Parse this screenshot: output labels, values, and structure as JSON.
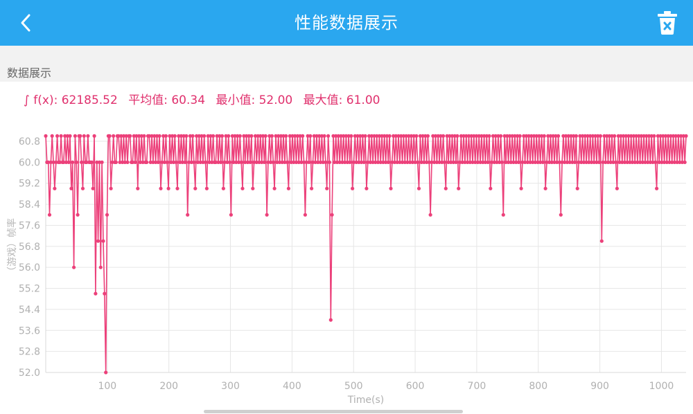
{
  "header": {
    "title": "性能数据展示",
    "back_icon": "chevron-left-icon",
    "delete_icon": "trash-icon",
    "bar_color": "#2aa7ef"
  },
  "section": {
    "label": "数据展示"
  },
  "summary": {
    "integral": "∫ f(x): 62185.52",
    "average": "平均值: 60.34",
    "min": "最小值: 52.00",
    "max": "最大值: 61.00"
  },
  "chart_data": {
    "type": "line",
    "xlabel": "Time(s)",
    "ylabel": "（游戏）帧率",
    "ylim": [
      52.0,
      60.8
    ],
    "xlim": [
      0,
      1040
    ],
    "y_ticks": [
      "52.0",
      "52.8",
      "53.6",
      "54.4",
      "55.2",
      "56.0",
      "56.8",
      "57.6",
      "58.4",
      "59.2",
      "60.0",
      "60.8"
    ],
    "x_ticks": [
      "100",
      "200",
      "300",
      "400",
      "500",
      "600",
      "700",
      "800",
      "900",
      "1000"
    ],
    "grid": true,
    "line_color": "#ec407a",
    "series": [
      {
        "values": [
          61,
          60,
          60,
          58,
          60,
          61,
          60,
          59,
          60,
          61,
          60,
          60,
          61,
          60,
          60,
          61,
          60,
          61,
          60,
          61,
          59,
          60,
          56,
          61,
          60,
          58,
          61,
          61,
          60,
          59,
          61,
          60,
          60,
          61,
          60,
          60,
          60,
          59,
          61,
          55,
          60,
          57,
          60,
          56,
          60,
          57,
          55,
          52,
          58,
          61,
          61,
          59,
          60,
          61,
          60,
          60,
          61,
          61,
          60,
          61,
          60,
          61,
          60,
          61,
          60,
          61,
          61,
          60,
          60,
          61,
          60,
          61,
          59,
          61,
          60,
          61,
          60,
          61,
          60,
          60,
          61,
          61,
          60,
          61,
          60,
          61,
          60,
          61,
          60,
          61,
          59,
          60,
          61,
          60,
          61,
          60,
          59,
          61,
          60,
          61,
          60,
          61,
          60,
          59,
          61,
          60,
          61,
          60,
          61,
          60,
          61,
          58,
          60,
          61,
          60,
          61,
          60,
          59,
          61,
          60,
          61,
          60,
          61,
          60,
          61,
          60,
          59,
          61,
          60,
          61,
          60,
          61,
          60,
          60,
          61,
          60,
          61,
          60,
          61,
          59,
          60,
          61,
          60,
          61,
          60,
          58,
          61,
          60,
          61,
          60,
          61,
          60,
          61,
          60,
          59,
          61,
          60,
          61,
          60,
          61,
          60,
          61,
          59,
          60,
          61,
          60,
          61,
          60,
          61,
          60,
          61,
          60,
          61,
          58,
          60,
          61,
          60,
          61,
          60,
          59,
          61,
          60,
          61,
          60,
          61,
          60,
          61,
          60,
          61,
          60,
          59,
          61,
          60,
          61,
          60,
          61,
          60,
          61,
          60,
          61,
          60,
          61,
          60,
          58,
          60,
          61,
          60,
          61,
          59,
          60,
          61,
          60,
          61,
          60,
          61,
          60,
          61,
          60,
          61,
          60,
          59,
          61,
          60,
          54,
          58,
          61,
          60,
          61,
          60,
          61,
          60,
          61,
          60,
          61,
          60,
          61,
          60,
          61,
          60,
          61,
          59,
          60,
          61,
          60,
          61,
          60,
          61,
          60,
          61,
          60,
          61,
          59,
          60,
          61,
          60,
          61,
          60,
          61,
          60,
          61,
          60,
          61,
          60,
          61,
          60,
          61,
          60,
          61,
          60,
          61,
          59,
          60,
          61,
          60,
          61,
          60,
          61,
          60,
          61,
          60,
          61,
          60,
          61,
          60,
          61,
          60,
          61,
          60,
          61,
          60,
          61,
          60,
          59,
          61,
          60,
          61,
          60,
          61,
          60,
          61,
          60,
          58,
          60,
          61,
          60,
          61,
          60,
          61,
          60,
          61,
          60,
          61,
          60,
          59,
          61,
          60,
          61,
          60,
          61,
          60,
          61,
          60,
          61,
          59,
          60,
          61,
          60,
          61,
          60,
          61,
          60,
          61,
          60,
          61,
          60,
          61,
          60,
          61,
          60,
          61,
          60,
          61,
          60,
          61,
          60,
          61,
          60,
          61,
          59,
          60,
          61,
          60,
          61,
          60,
          61,
          60,
          61,
          60,
          58,
          61,
          60,
          61,
          60,
          61,
          60,
          61,
          60,
          61,
          60,
          61,
          60,
          61,
          59,
          60,
          61,
          60,
          61,
          60,
          61,
          60,
          61,
          60,
          61,
          60,
          61,
          60,
          61,
          60,
          61,
          60,
          61,
          59,
          60,
          61,
          60,
          61,
          60,
          61,
          60,
          61,
          60,
          61,
          60,
          58,
          60,
          61,
          60,
          61,
          60,
          61,
          60,
          61,
          60,
          61,
          60,
          61,
          59,
          60,
          61,
          60,
          61,
          60,
          61,
          60,
          61,
          60,
          61,
          60,
          61,
          60,
          61,
          60,
          61,
          60,
          61,
          57,
          60,
          61,
          60,
          61,
          60,
          61,
          60,
          61,
          60,
          61,
          60,
          59,
          61,
          60,
          61,
          60,
          61,
          60,
          61,
          60,
          61,
          60,
          61,
          60,
          61,
          60,
          61,
          60,
          61,
          60,
          61,
          60,
          61,
          60,
          61,
          60,
          61,
          60,
          61,
          60,
          61,
          60,
          59,
          61,
          60,
          61,
          60,
          61,
          60,
          61,
          60,
          61,
          60,
          61,
          60,
          61,
          60,
          61,
          60,
          61,
          60,
          61,
          60,
          61,
          60,
          61
        ]
      }
    ]
  }
}
